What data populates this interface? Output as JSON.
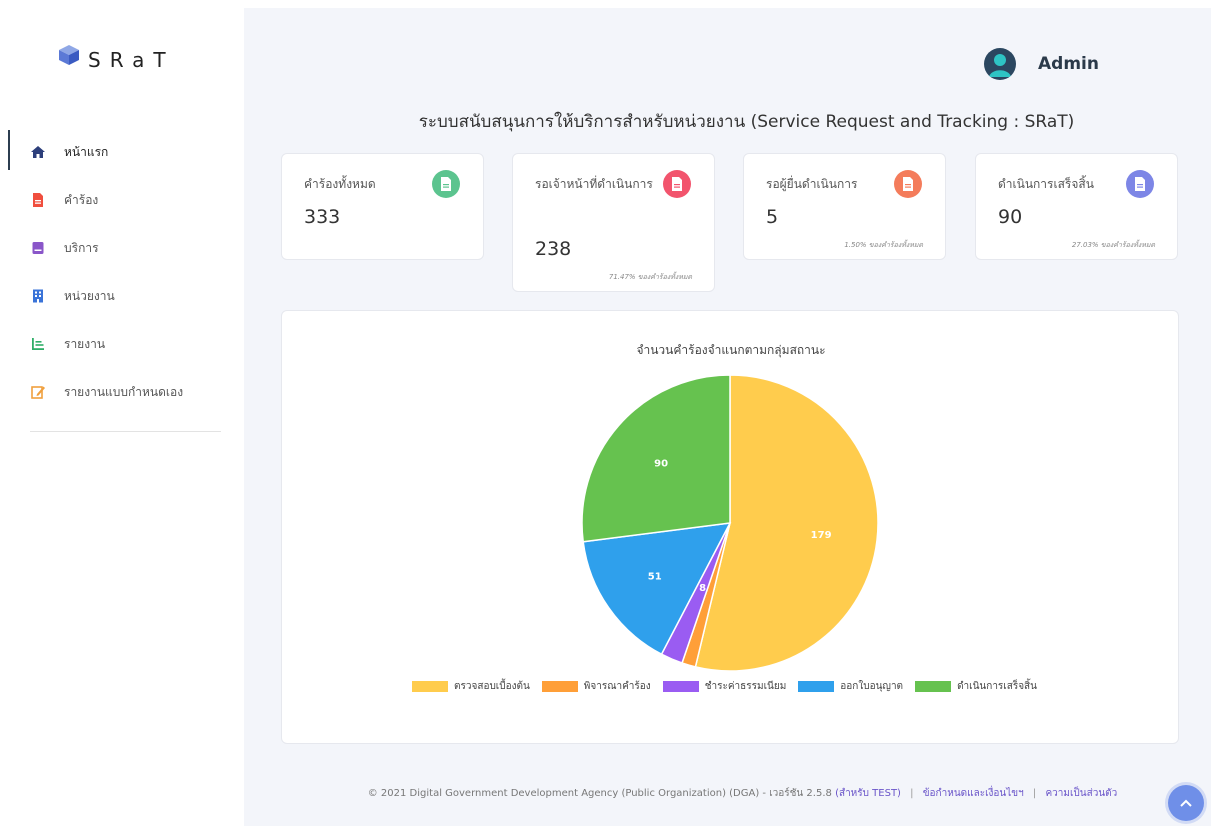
{
  "app": {
    "logo_text": "SRaT"
  },
  "sidebar": {
    "items": [
      {
        "label": "หน้าแรก",
        "icon": "home-icon",
        "color": "#2c3e7a",
        "active": true
      },
      {
        "label": "คำร้อง",
        "icon": "file-icon",
        "color": "#f04e3e"
      },
      {
        "label": "บริการ",
        "icon": "book-icon",
        "color": "#8a56c9"
      },
      {
        "label": "หน่วยงาน",
        "icon": "building-icon",
        "color": "#3a73d8"
      },
      {
        "label": "รายงาน",
        "icon": "chart-icon",
        "color": "#2fae67"
      },
      {
        "label": "รายงานแบบกำหนดเอง",
        "icon": "edit-icon",
        "color": "#f0a03e"
      }
    ]
  },
  "header": {
    "user_name": "Admin"
  },
  "page": {
    "title": "ระบบสนับสนุนการให้บริการสำหรับหน่วยงาน (Service Request and Tracking : SRaT)"
  },
  "stats": [
    {
      "title": "คำร้องทั้งหมด",
      "value": "333",
      "note": "",
      "badge_color": "#5cc48f"
    },
    {
      "title": "รอเจ้าหน้าที่ดำเนินการ",
      "value": "238",
      "note": "71.47% ของคำร้องทั้งหมด",
      "badge_color": "#f2546d"
    },
    {
      "title": "รอผู้ยื่นดำเนินการ",
      "value": "5",
      "note": "1.50% ของคำร้องทั้งหมด",
      "badge_color": "#f47c5b"
    },
    {
      "title": "ดำเนินการเสร็จสิ้น",
      "value": "90",
      "note": "27.03% ของคำร้องทั้งหมด",
      "badge_color": "#7d86e6"
    }
  ],
  "chart_data": {
    "type": "pie",
    "title": "จำนวนคำร้องจำแนกตามกลุ่มสถานะ",
    "categories": [
      "ตรวจสอบเบื้องต้น",
      "พิจารณาคำร้อง",
      "ชำระค่าธรรมเนียม",
      "ออกใบอนุญาต",
      "ดำเนินการเสร็จสิ้น"
    ],
    "values": [
      179,
      5,
      8,
      51,
      90
    ],
    "colors": [
      "#ffcc4d",
      "#ff9f38",
      "#9a5cf2",
      "#2fa0ec",
      "#66c24f"
    ],
    "legend_position": "bottom"
  },
  "footer": {
    "copyright": "© 2021 Digital Government Development Agency (Public Organization) (DGA) - เวอร์ชัน 2.5.8",
    "env_link": "(สำหรับ TEST)",
    "terms_link": "ข้อกำหนดและเงื่อนไขฯ",
    "privacy_link": "ความเป็นส่วนตัว"
  }
}
